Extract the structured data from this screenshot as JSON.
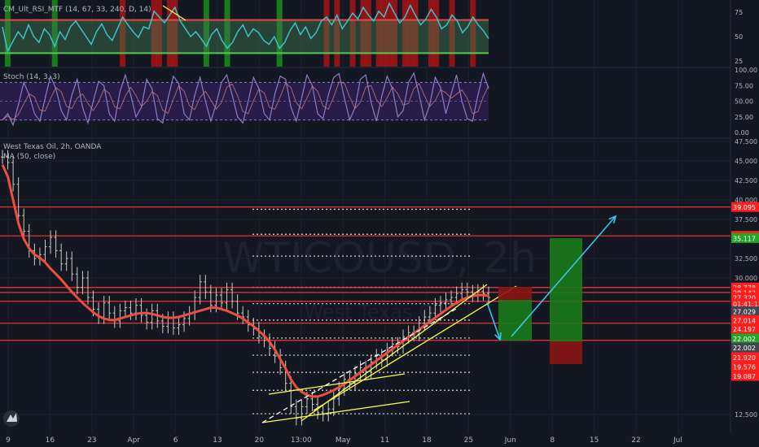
{
  "colors": {
    "background": "#131722",
    "grid": "#1e2230",
    "rsi_line": "#3fc1c9",
    "stoch_line": "#8e7cc3",
    "stoch_band": "#2b1f4f",
    "price_bars": "#c8ccc0",
    "ma_line": "#f04d3f",
    "level_line": "#ff3333",
    "trend_line": "#ffff44",
    "arrow": "#35c6e8",
    "target_box": "#1b7a1b",
    "stop_box": "#8c1414",
    "axis_text": "#b2b5be",
    "label_red": "#ff1e1e",
    "label_green": "#26a626",
    "label_dark": "#434651"
  },
  "panes": {
    "rsi": {
      "title": "CM_Ult_RSI_MTF (14, 67, 33, 240, D, 14)"
    },
    "stoch": {
      "title": "Stoch (14, 3, 3)"
    },
    "price": {
      "title": "West Texas Oil, 2h, OANDA",
      "indicator": "MA (50, close)"
    }
  },
  "watermark": {
    "symbol": "WTICOUSD, 2h",
    "name": "West Texas Oil"
  },
  "chart_data": [
    {
      "type": "line",
      "name": "rsi",
      "title": "CM_Ult_RSI_MTF (14, 67, 33, 240, D, 14)",
      "ylim": [
        0,
        100
      ],
      "yticks": [
        "75",
        "50",
        "25"
      ],
      "upper_band": 67,
      "lower_band": 33,
      "series": [
        {
          "values": [
            60,
            35,
            45,
            55,
            48,
            62,
            50,
            44,
            58,
            52,
            40,
            55,
            47,
            60,
            66,
            58,
            50,
            42,
            55,
            63,
            52,
            46,
            58,
            70,
            62,
            55,
            49,
            60,
            58,
            76,
            70,
            64,
            72,
            80,
            66,
            58,
            50,
            55,
            48,
            40,
            52,
            58,
            46,
            38,
            44,
            55,
            62,
            50,
            58,
            54,
            46,
            42,
            50,
            38,
            44,
            56,
            64,
            52,
            60,
            48,
            54,
            66,
            70,
            62,
            72,
            58,
            66,
            74,
            68,
            80,
            72,
            66,
            76,
            70,
            84,
            74,
            64,
            70,
            82,
            72,
            62,
            68,
            78,
            70,
            58,
            62,
            72,
            66,
            54,
            60,
            70,
            62,
            56,
            48
          ]
        }
      ]
    },
    {
      "type": "line",
      "name": "stoch",
      "title": "Stoch (14, 3, 3)",
      "ylim": [
        0,
        100
      ],
      "yticks": [
        "100.00",
        "75.00",
        "50.00",
        "25.00",
        "0.00"
      ],
      "upper_band": 80,
      "lower_band": 20,
      "series": [
        {
          "values": [
            20,
            30,
            12,
            45,
            80,
            60,
            30,
            18,
            55,
            90,
            70,
            35,
            20,
            60,
            85,
            40,
            15,
            50,
            82,
            75,
            30,
            18,
            65,
            92,
            60,
            25,
            40,
            85,
            70,
            22,
            15,
            55,
            90,
            78,
            30,
            20,
            60,
            88,
            50,
            18,
            45,
            80,
            92,
            60,
            25,
            15,
            50,
            88,
            70,
            30,
            20,
            62,
            90,
            85,
            40,
            18,
            55,
            92,
            75,
            30,
            22,
            60,
            88,
            94,
            55,
            20,
            40,
            85,
            92,
            48,
            18,
            58,
            90,
            70,
            25,
            35,
            80,
            95,
            60,
            20,
            45,
            88,
            72,
            30,
            62,
            92,
            50,
            22,
            18,
            60,
            94,
            70
          ]
        }
      ]
    },
    {
      "type": "line",
      "name": "price",
      "title": "West Texas Oil, 2h, OANDA",
      "ylim": [
        10,
        47.5
      ],
      "yticks": [
        "47.500",
        "45.000",
        "42.500",
        "40.000",
        "37.500",
        "32.500",
        "30.000",
        "12.500"
      ],
      "xticks": [
        "9",
        "16",
        "23",
        "Apr",
        "6",
        "13",
        "20",
        "13:00",
        "May",
        "11",
        "18",
        "25",
        "Jun",
        "8",
        "15",
        "22",
        "Jul"
      ],
      "series": [
        {
          "values": [
            45.5,
            44.8,
            42.0,
            38.0,
            36.0,
            33.5,
            32.5,
            33.0,
            34.0,
            35.2,
            33.5,
            31.8,
            32.5,
            30.5,
            28.8,
            30.0,
            27.5,
            26.0,
            25.0,
            26.8,
            25.5,
            24.5,
            25.8,
            26.2,
            25.5,
            26.5,
            25.2,
            24.3,
            25.8,
            24.5,
            23.8,
            24.8,
            23.6,
            24.0,
            24.8,
            25.5,
            27.5,
            29.5,
            28.2,
            26.5,
            27.8,
            26.8,
            28.5,
            27.0,
            25.5,
            25.0,
            24.0,
            23.5,
            22.5,
            22.0,
            21.0,
            20.0,
            18.5,
            16.5,
            13.5,
            12.0,
            13.5,
            14.5,
            13.8,
            12.8,
            12.5,
            13.2,
            14.5,
            15.8,
            17.0,
            16.5,
            17.8,
            18.5,
            18.0,
            19.2,
            20.0,
            19.5,
            20.8,
            21.5,
            21.2,
            22.5,
            23.0,
            22.8,
            24.2,
            25.0,
            25.5,
            26.5,
            26.8,
            27.2,
            27.5,
            28.0,
            28.5,
            28.2,
            27.8,
            28.3,
            28.0,
            27.5
          ]
        },
        {
          "name": "MA (50, close)",
          "values": [
            44.5,
            43.0,
            40.0,
            37.0,
            35.0,
            33.8,
            33.0,
            32.6,
            32.0,
            31.2,
            30.5,
            29.8,
            29.0,
            28.2,
            27.5,
            26.8,
            26.2,
            25.6,
            25.1,
            24.8,
            24.6,
            24.6,
            24.8,
            25.0,
            25.2,
            25.4,
            25.5,
            25.5,
            25.4,
            25.2,
            25.0,
            24.9,
            24.9,
            25.0,
            25.2,
            25.4,
            25.6,
            25.8,
            26.0,
            26.2,
            26.2,
            26.0,
            25.8,
            25.5,
            25.2,
            24.8,
            24.3,
            23.8,
            23.2,
            22.6,
            21.8,
            20.8,
            19.6,
            18.4,
            17.0,
            16.0,
            15.4,
            15.0,
            14.8,
            14.8,
            15.0,
            15.3,
            15.6,
            16.0,
            16.4,
            16.9,
            17.4,
            17.9,
            18.4,
            18.9,
            19.4,
            19.9,
            20.4,
            20.9,
            21.4,
            21.9,
            22.4,
            22.9,
            23.4,
            23.9,
            24.4,
            24.9,
            25.4,
            25.9,
            26.4,
            26.8,
            27.2,
            27.5,
            27.7,
            27.8,
            27.8,
            27.7
          ]
        }
      ],
      "levels": [
        39.095,
        35.398,
        28.778,
        28.143,
        27.014,
        24.197,
        22.002
      ],
      "dotted_levels": [
        38.8,
        35.6,
        32.8,
        28.8,
        26.7,
        24.6,
        22.3,
        20.1,
        17.9,
        15.6,
        12.6
      ],
      "price_labels": [
        {
          "text": "39.095",
          "value": 39.095,
          "style": "red"
        },
        {
          "text": "35.398",
          "value": 35.398,
          "style": "red"
        },
        {
          "text": "35.117",
          "value": 35.117,
          "style": "green"
        },
        {
          "text": "28.778",
          "value": 28.778,
          "style": "red"
        },
        {
          "text": "28.143",
          "value": 28.143,
          "style": "red"
        },
        {
          "text": "27.320",
          "value": 27.5,
          "style": "red"
        },
        {
          "text": "01:41:12",
          "value": 26.7,
          "style": "red"
        },
        {
          "text": "27.029",
          "value": 25.75,
          "style": "dark"
        },
        {
          "text": "27.014",
          "value": 24.6,
          "style": "red"
        },
        {
          "text": "24.197",
          "value": 23.5,
          "style": "red"
        },
        {
          "text": "22.002",
          "value": 22.25,
          "style": "green"
        },
        {
          "text": "22.002",
          "value": 21.1,
          "style": "dark"
        },
        {
          "text": "21.920",
          "value": 19.85,
          "style": "red"
        },
        {
          "text": "19.576",
          "value": 18.65,
          "style": "red"
        },
        {
          "text": "19.087",
          "value": 17.45,
          "style": "red"
        }
      ]
    }
  ]
}
